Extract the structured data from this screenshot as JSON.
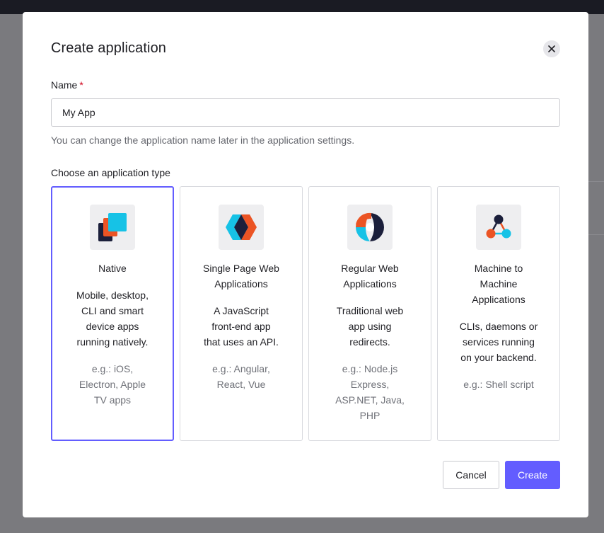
{
  "modal": {
    "title": "Create application",
    "close_icon": "close-icon"
  },
  "name_field": {
    "label": "Name",
    "required_marker": "*",
    "value": "My App",
    "help": "You can change the application name later in the application settings."
  },
  "app_types": {
    "label": "Choose an application type",
    "selected": "Native",
    "cards": [
      {
        "icon": "native-app-icon",
        "title_lines": [
          "Native"
        ],
        "desc_lines": [
          "Mobile, desktop,",
          "CLI and smart",
          "device apps",
          "running natively."
        ],
        "example_lines": [
          "e.g.: iOS,",
          "Electron, Apple",
          "TV apps"
        ]
      },
      {
        "icon": "spa-app-icon",
        "title_lines": [
          "Single Page Web",
          "Applications"
        ],
        "desc_lines": [
          "A JavaScript",
          "front-end app",
          "that uses an API."
        ],
        "example_lines": [
          "e.g.: Angular,",
          "React, Vue"
        ]
      },
      {
        "icon": "regular-web-app-icon",
        "title_lines": [
          "Regular Web",
          "Applications"
        ],
        "desc_lines": [
          "Traditional web",
          "app using",
          "redirects."
        ],
        "example_lines": [
          "e.g.: Node.js",
          "Express,",
          "ASP.NET, Java,",
          "PHP"
        ]
      },
      {
        "icon": "m2m-app-icon",
        "title_lines": [
          "Machine to",
          "Machine",
          "Applications"
        ],
        "desc_lines": [
          "CLIs, daemons or",
          "services running",
          "on your backend."
        ],
        "example_lines": [
          "e.g.: Shell script"
        ]
      }
    ]
  },
  "footer": {
    "cancel_label": "Cancel",
    "create_label": "Create"
  },
  "colors": {
    "accent": "#635dff",
    "required": "#d0021b",
    "backdrop": "#7a7a7e"
  }
}
